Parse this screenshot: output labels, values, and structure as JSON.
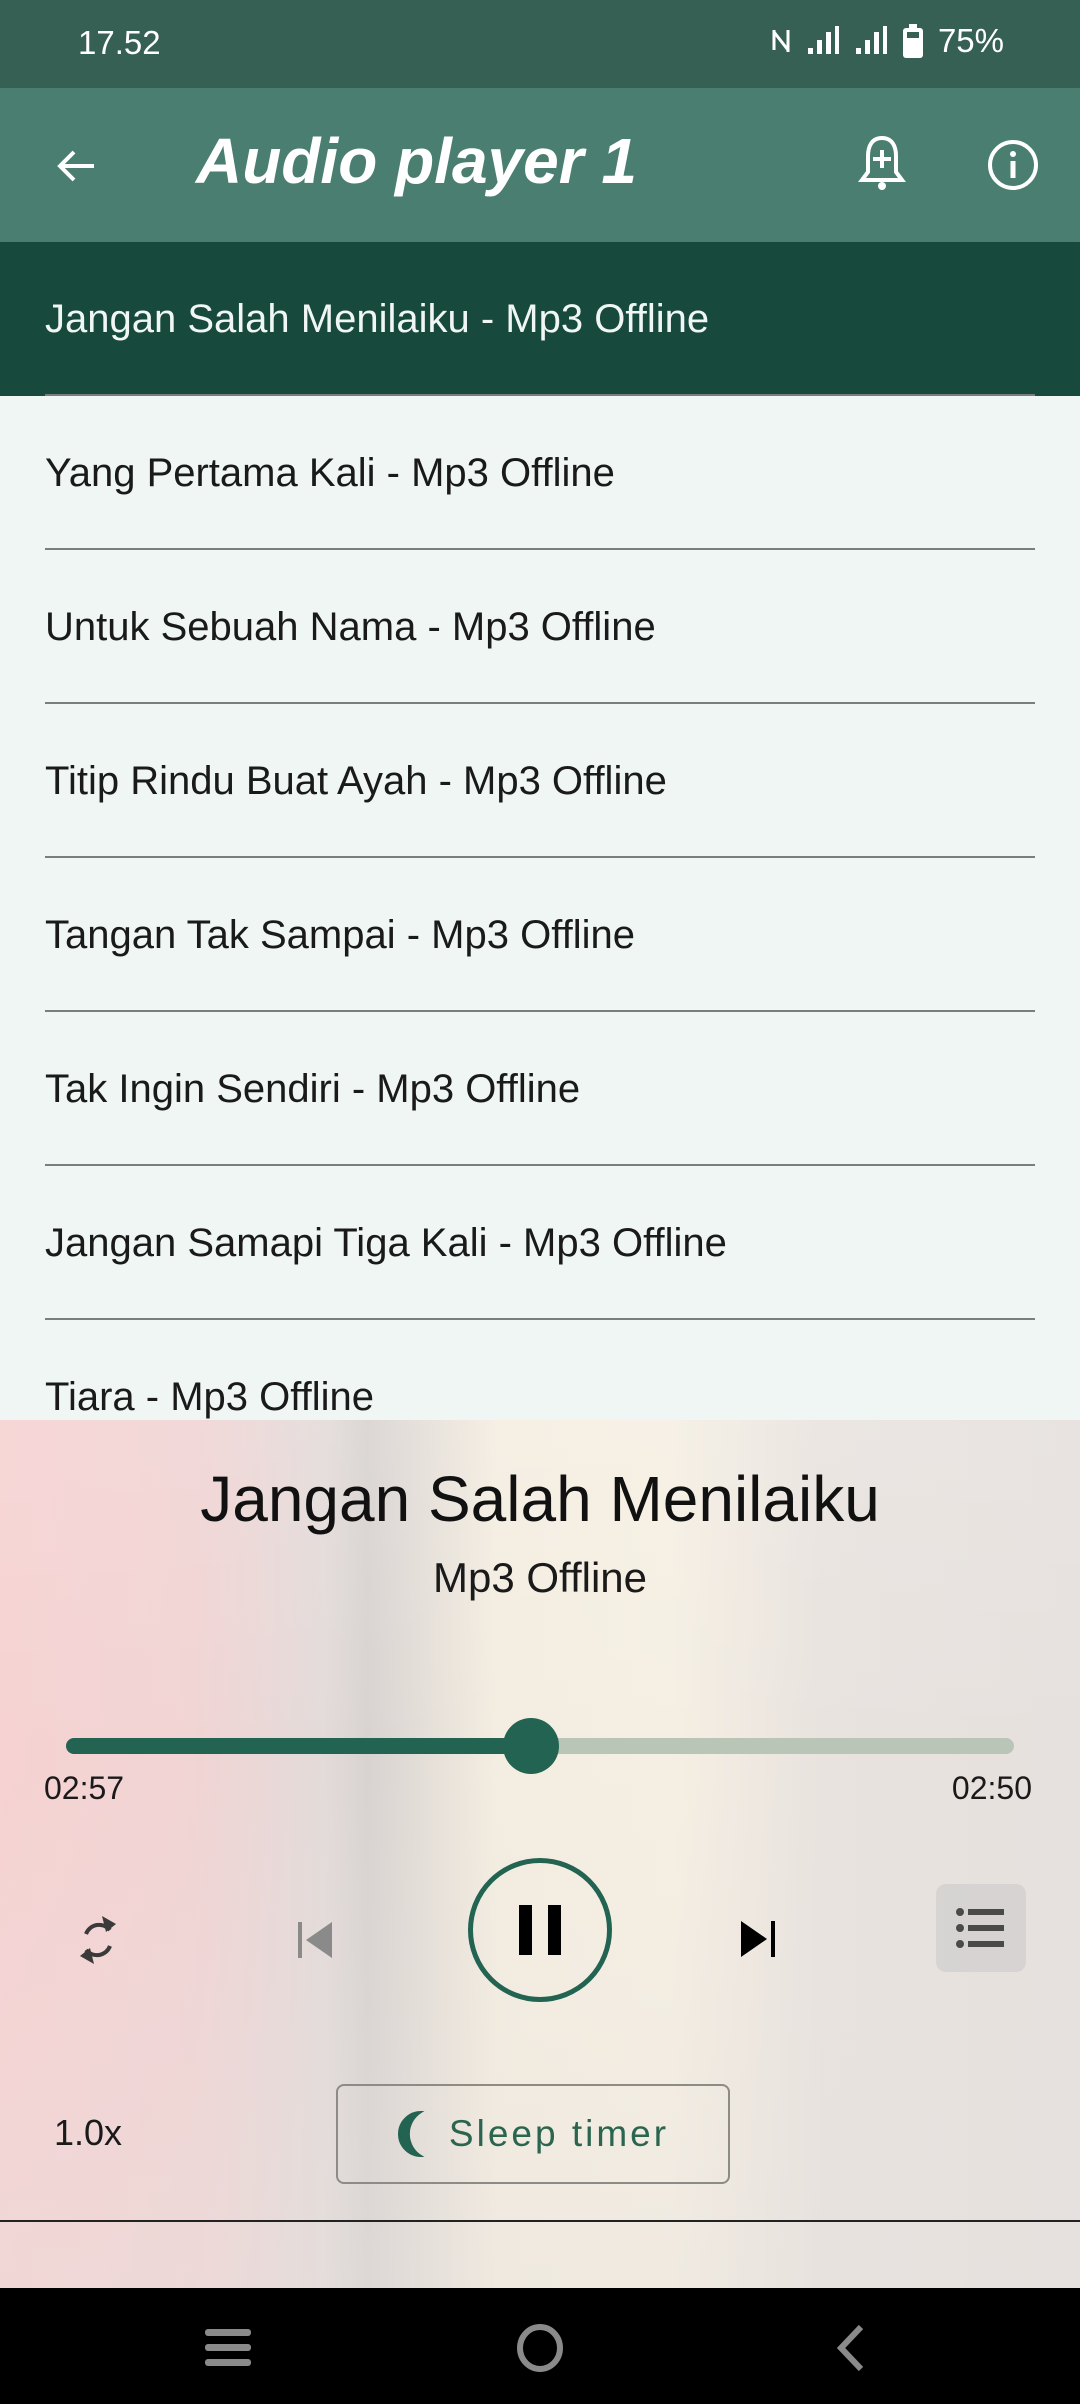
{
  "status_bar": {
    "time": "17.52",
    "icons": [
      "nfc-icon",
      "signal-icon",
      "signal-icon",
      "battery-icon"
    ],
    "battery_percent": "75%"
  },
  "app_bar": {
    "title": "Audio player 1",
    "back_icon": "arrow-left-icon",
    "actions": [
      "bell-plus-icon",
      "info-icon"
    ]
  },
  "playlist": {
    "items": [
      {
        "label": "Jangan Salah Menilaiku - Mp3 Offline",
        "selected": true
      },
      {
        "label": "Yang Pertama Kali - Mp3 Offline",
        "selected": false
      },
      {
        "label": "Untuk Sebuah Nama - Mp3 Offline",
        "selected": false
      },
      {
        "label": "Titip Rindu Buat Ayah - Mp3 Offline",
        "selected": false
      },
      {
        "label": "Tangan Tak Sampai - Mp3 Offline",
        "selected": false
      },
      {
        "label": "Tak Ingin Sendiri - Mp3 Offline",
        "selected": false
      },
      {
        "label": "Jangan Samapi Tiga Kali - Mp3 Offline",
        "selected": false
      },
      {
        "label": "Tiara - Mp3 Offline",
        "selected": false
      }
    ]
  },
  "player": {
    "title": "Jangan Salah Menilaiku",
    "subtitle": "Mp3 Offline",
    "progress_fraction": 0.49,
    "elapsed": "02:57",
    "total": "02:50",
    "controls": [
      "repeat-icon",
      "skip-previous-icon",
      "pause-icon",
      "skip-next-icon",
      "queue-list-icon"
    ],
    "speed": "1.0x",
    "sleep_timer_label": "Sleep timer"
  },
  "nav_bar": {
    "buttons": [
      "recents-icon",
      "home-icon",
      "back-icon"
    ]
  },
  "colors": {
    "status_bar": "#366053",
    "app_bar": "#4a7e70",
    "selected_row": "#18493d",
    "accent": "#226351",
    "list_bg": "#eff6f3"
  }
}
